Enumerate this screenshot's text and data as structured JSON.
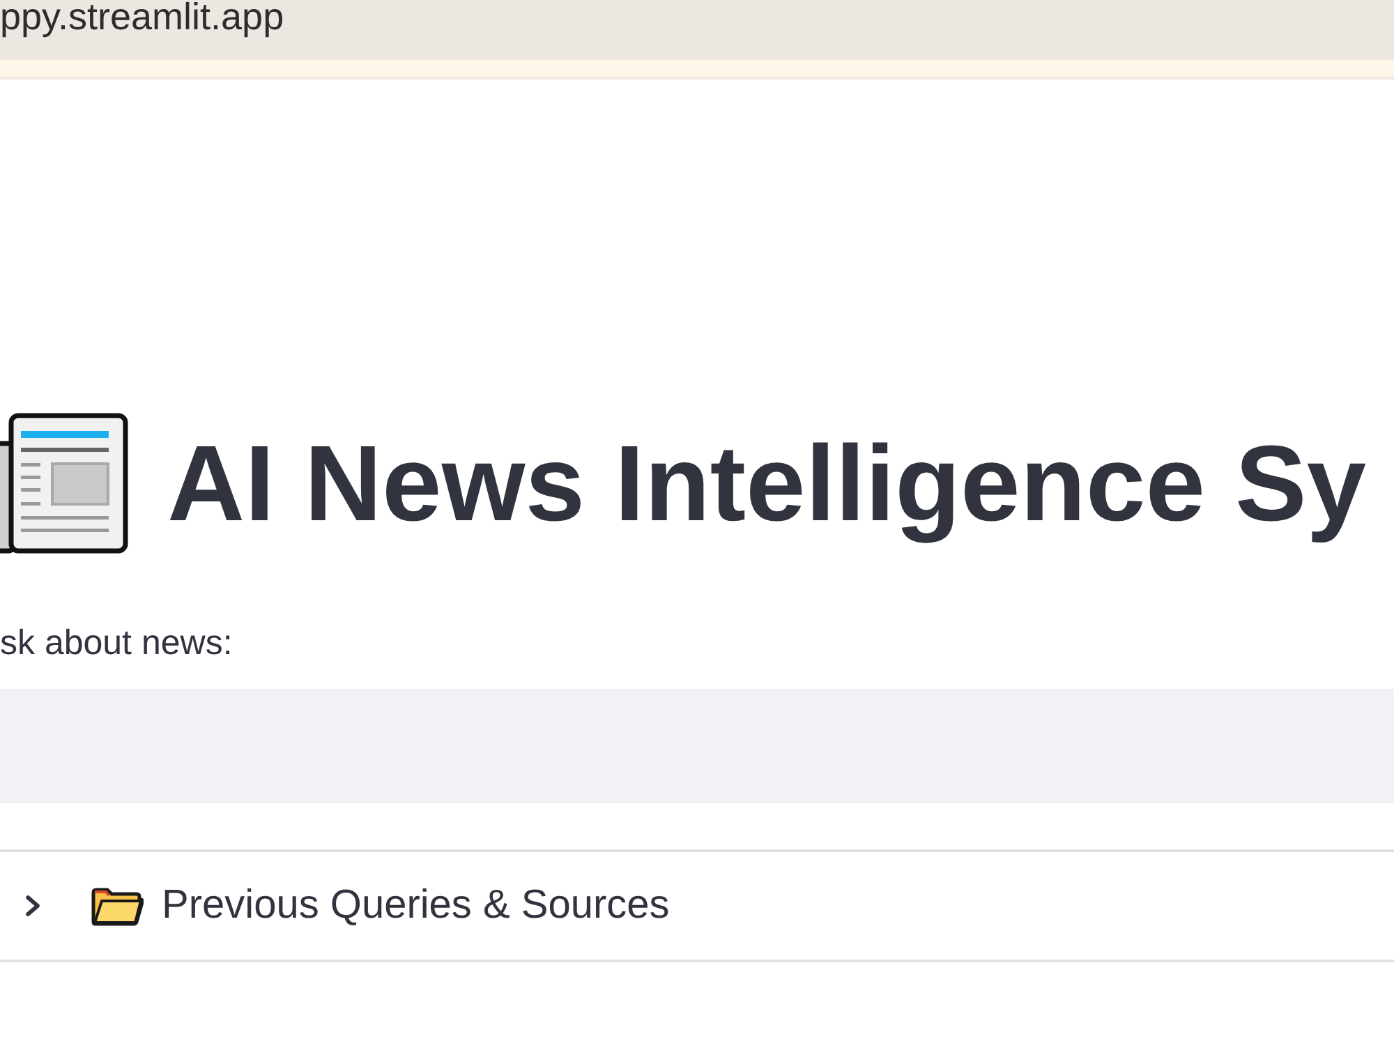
{
  "browser": {
    "address": "ppy.streamlit.app"
  },
  "page": {
    "title": "AI News Intelligence Sy",
    "query_input": {
      "label": "sk about news:"
    },
    "expander": {
      "label": "Previous Queries & Sources",
      "expanded": false
    }
  }
}
